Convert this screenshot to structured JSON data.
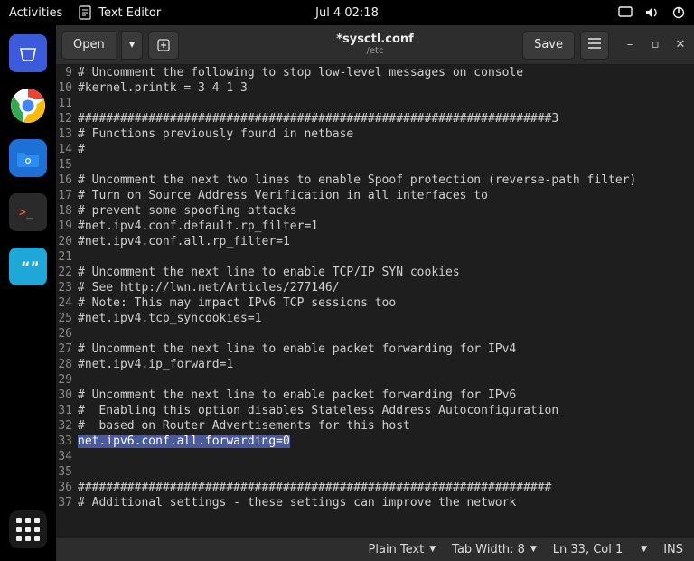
{
  "topbar": {
    "activities": "Activities",
    "app_name": "Text Editor",
    "clock": "Jul 4  02:18"
  },
  "tooltip": {
    "show_apps": "Show Applications"
  },
  "header": {
    "open": "Open",
    "title": "*sysctl.conf",
    "subtitle": "/etc",
    "save": "Save"
  },
  "lines": [
    {
      "n": 9,
      "t": "# Uncomment the following to stop low-level messages on console"
    },
    {
      "n": 10,
      "t": "#kernel.printk = 3 4 1 3"
    },
    {
      "n": 11,
      "t": ""
    },
    {
      "n": 12,
      "t": "###################################################################3"
    },
    {
      "n": 13,
      "t": "# Functions previously found in netbase"
    },
    {
      "n": 14,
      "t": "#"
    },
    {
      "n": 15,
      "t": ""
    },
    {
      "n": 16,
      "t": "# Uncomment the next two lines to enable Spoof protection (reverse-path filter)"
    },
    {
      "n": 17,
      "t": "# Turn on Source Address Verification in all interfaces to"
    },
    {
      "n": 18,
      "t": "# prevent some spoofing attacks"
    },
    {
      "n": 19,
      "t": "#net.ipv4.conf.default.rp_filter=1"
    },
    {
      "n": 20,
      "t": "#net.ipv4.conf.all.rp_filter=1"
    },
    {
      "n": 21,
      "t": ""
    },
    {
      "n": 22,
      "t": "# Uncomment the next line to enable TCP/IP SYN cookies"
    },
    {
      "n": 23,
      "t": "# See http://lwn.net/Articles/277146/"
    },
    {
      "n": 24,
      "t": "# Note: This may impact IPv6 TCP sessions too"
    },
    {
      "n": 25,
      "t": "#net.ipv4.tcp_syncookies=1"
    },
    {
      "n": 26,
      "t": ""
    },
    {
      "n": 27,
      "t": "# Uncomment the next line to enable packet forwarding for IPv4"
    },
    {
      "n": 28,
      "t": "#net.ipv4.ip_forward=1"
    },
    {
      "n": 29,
      "t": ""
    },
    {
      "n": 30,
      "t": "# Uncomment the next line to enable packet forwarding for IPv6"
    },
    {
      "n": 31,
      "t": "#  Enabling this option disables Stateless Address Autoconfiguration"
    },
    {
      "n": 32,
      "t": "#  based on Router Advertisements for this host"
    },
    {
      "n": 33,
      "t": "net.ipv6.conf.all.forwarding=0",
      "sel": true
    },
    {
      "n": 34,
      "t": ""
    },
    {
      "n": 35,
      "t": ""
    },
    {
      "n": 36,
      "t": "###################################################################"
    },
    {
      "n": 37,
      "t": "# Additional settings - these settings can improve the network"
    }
  ],
  "status": {
    "plain_text": "Plain Text",
    "tab_width": "Tab Width: 8",
    "cursor": "Ln 33, Col 1",
    "ins": "INS"
  }
}
